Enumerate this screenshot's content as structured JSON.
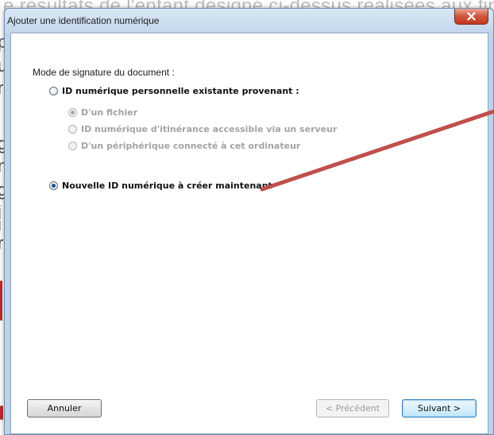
{
  "background": {
    "top_text": "e résultats de l'enfant désigné ci-dessus réalisées aux fins",
    "left_letters": [
      "p",
      "u",
      "r",
      "g",
      "n",
      "g",
      "i",
      "i",
      "r"
    ]
  },
  "dialog": {
    "title": "Ajouter une identification numérique",
    "close_label": "×",
    "section_label": "Mode de signature du document :",
    "options": {
      "existing": "ID numérique personnelle existante provenant :",
      "from_file": "D'un fichier",
      "roaming": "ID numérique d'itinérance accessible via un serveur",
      "device": "D'un périphérique connecté à cet ordinateur",
      "new_id": "Nouvelle ID numérique à créer maintenant"
    },
    "buttons": {
      "cancel": "Annuler",
      "previous": "< Précédent",
      "next": "Suivant >"
    }
  },
  "colors": {
    "annotation_arrow": "#c0504d",
    "title_bar": "#c3d7ec",
    "close_button": "#c9452b"
  }
}
